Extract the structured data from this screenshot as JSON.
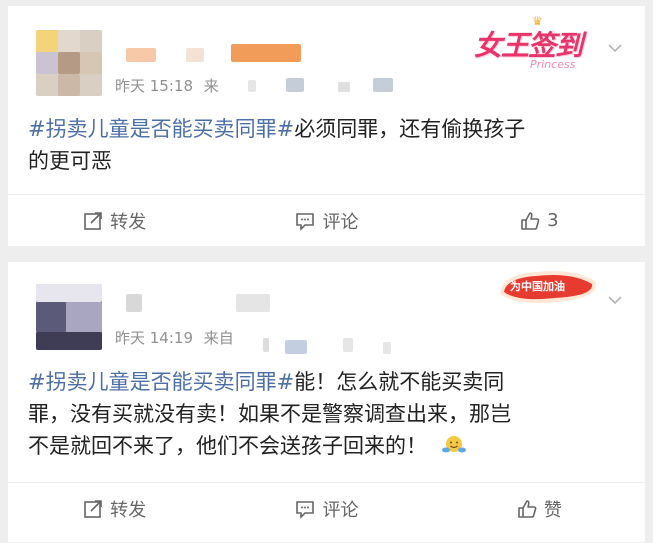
{
  "posts": [
    {
      "time": "昨天 15:18",
      "source_prefix": "来",
      "badge_text": "女王签到",
      "badge_sub": "Princess",
      "badge_color": "#e8336b",
      "topic": "#拐卖儿童是否能买卖同罪#",
      "line1_rest": "必须同罪，还有偷换孩子",
      "line2": "的更可恶",
      "actions": {
        "repost": "转发",
        "comment": "评论",
        "like": "3"
      }
    },
    {
      "time": "昨天 14:19",
      "source_prefix": "来自",
      "badge_text": "为中国加油",
      "badge_color": "#e83b2f",
      "topic": "#拐卖儿童是否能买卖同罪#",
      "line1_rest": "能！怎么就不能买卖同",
      "line2": "罪，没有买就没有卖！如果不是警察调查出来，那岂",
      "line3": "不是就回不来了，他们不会送孩子回来的！",
      "emoji": "hugging-emoji",
      "actions": {
        "repost": "转发",
        "comment": "评论",
        "like": "赞"
      }
    }
  ],
  "colors": {
    "topic": "#4d6fa8",
    "text": "#222222",
    "meta": "#909090",
    "icon": "#666666"
  }
}
